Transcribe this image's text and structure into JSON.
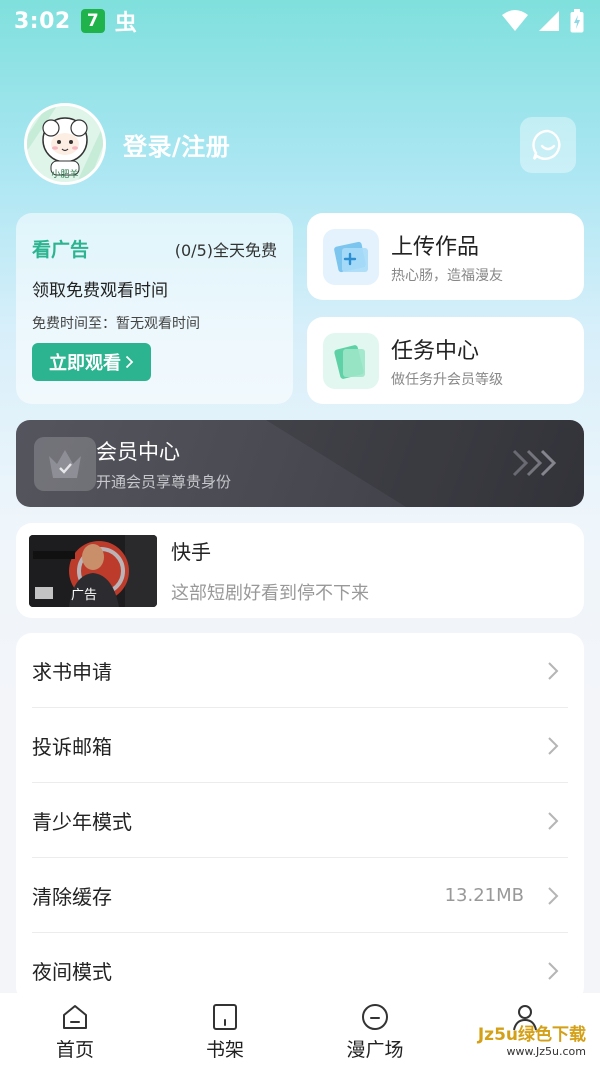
{
  "status_bar": {
    "time": "3:02",
    "badge": "7",
    "bug_glyph": "虫"
  },
  "profile": {
    "avatar_text": "小肥羊",
    "login_label": "登录/注册"
  },
  "ad_card": {
    "title": "看广告",
    "count": "(0/5)全天免费",
    "subtitle": "领取免费观看时间",
    "free_time": "免费时间至：暂无观看时间",
    "button_label": "立即观看"
  },
  "upload": {
    "title": "上传作品",
    "subtitle": "热心肠，造福漫友"
  },
  "tasks": {
    "title": "任务中心",
    "subtitle": "做任务升会员等级"
  },
  "vip": {
    "title": "会员中心",
    "subtitle": "开通会员享尊贵身份"
  },
  "advert": {
    "thumb_tag": "广告",
    "title": "快手",
    "description": "这部短剧好看到停不下来"
  },
  "menu": [
    {
      "label": "求书申请",
      "value": ""
    },
    {
      "label": "投诉邮箱",
      "value": ""
    },
    {
      "label": "青少年模式",
      "value": ""
    },
    {
      "label": "清除缓存",
      "value": "13.21MB"
    },
    {
      "label": "夜间模式",
      "value": ""
    }
  ],
  "tabs": [
    {
      "label": "首页",
      "icon": "home-icon"
    },
    {
      "label": "书架",
      "icon": "bookshelf-icon"
    },
    {
      "label": "漫广场",
      "icon": "plaza-icon"
    },
    {
      "label": "",
      "icon": "profile-icon"
    }
  ],
  "watermark": {
    "top": "Jz5u绿色下载",
    "bottom": "www.Jz5u.com"
  },
  "colors": {
    "accent": "#2bb48f",
    "vip_bg": "#4a4a52"
  }
}
